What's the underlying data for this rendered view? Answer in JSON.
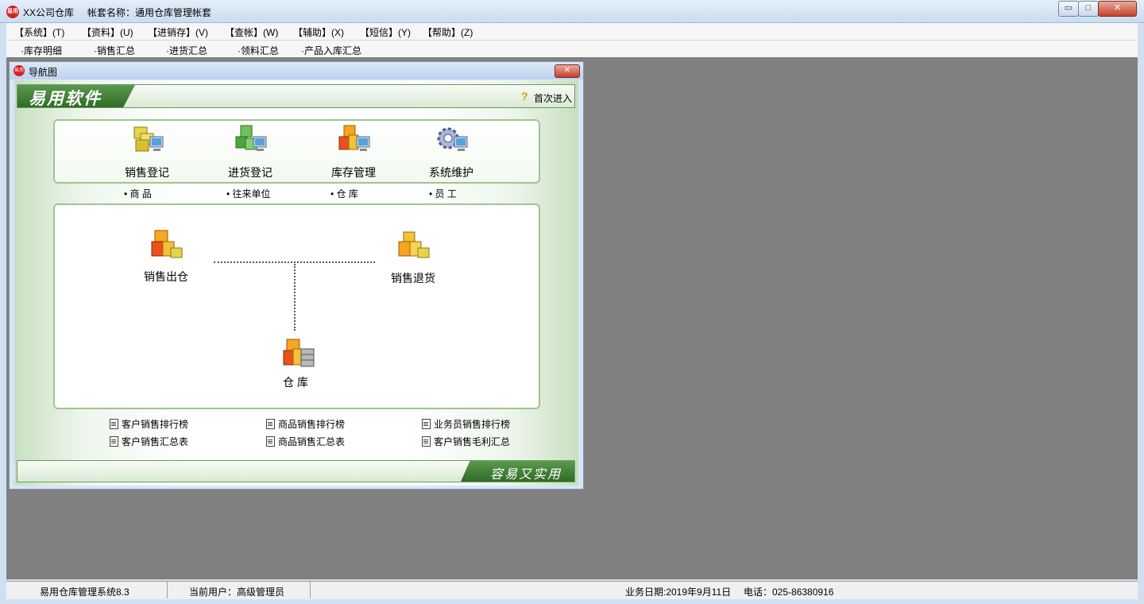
{
  "window": {
    "app_title": "XX公司仓库",
    "account_title": "帐套名称：通用仓库管理帐套",
    "icon_text": "易用",
    "min_label": "▭",
    "max_label": "□",
    "close_label": "✕"
  },
  "menu": [
    "【系统】(T)",
    "【资料】(U)",
    "【进销存】(V)",
    "【查帐】(W)",
    "【辅助】(X)",
    "【短信】(Y)",
    "【帮助】(Z)"
  ],
  "toolbar": [
    "·库存明细",
    "·销售汇总",
    "·进货汇总",
    "·领料汇总",
    "·产品入库汇总"
  ],
  "child": {
    "title": "导航图",
    "icon_text": "易用",
    "close_label": "✕",
    "banner_logo": "易用软件",
    "first_entry_icon": "?",
    "first_entry": "首次进入",
    "modules": [
      {
        "label": "销售登记",
        "icon": "sales-register-icon"
      },
      {
        "label": "进货登记",
        "icon": "purchase-register-icon"
      },
      {
        "label": "库存管理",
        "icon": "inventory-management-icon"
      },
      {
        "label": "系统维护",
        "icon": "system-maintenance-icon"
      }
    ],
    "sub_items": [
      "•  商  品",
      "•  往来单位",
      "•  仓  库",
      "•  员  工"
    ],
    "flow": {
      "out": "销售出仓",
      "return": "销售退货",
      "warehouse": "仓  库"
    },
    "reports": [
      [
        "客户销售排行榜",
        "商品销售排行榜",
        "业务员销售排行榜"
      ],
      [
        "客户销售汇总表",
        "商品销售汇总表",
        "客户销售毛利汇总"
      ]
    ],
    "slogan": "容易又实用"
  },
  "status": {
    "system": "易用仓库管理系统8.3",
    "user": "当前用户：高级管理员",
    "date": "业务日期:2019年9月11日",
    "phone": "电话：025-86380916"
  }
}
